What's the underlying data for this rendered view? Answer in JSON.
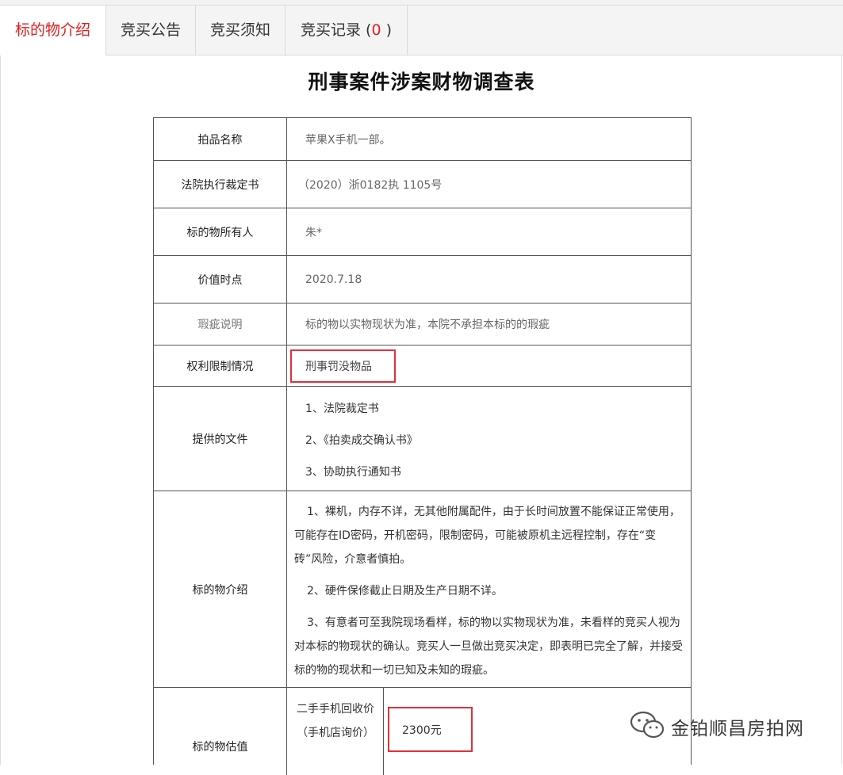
{
  "tabs": [
    {
      "label": "标的物介绍"
    },
    {
      "label": "竞买公告"
    },
    {
      "label": "竞买须知"
    },
    {
      "label": "竞买记录 (",
      "count": "0",
      "suffix": ")"
    }
  ],
  "title": "刑事案件涉案财物调查表",
  "rows": {
    "item_name": {
      "label": "拍品名称",
      "value": "苹果X手机一部。"
    },
    "court_ruling": {
      "label": "法院执行裁定书",
      "value": "（2020）浙0182执 1105号"
    },
    "owner": {
      "label": "标的物所有人",
      "value": "朱*"
    },
    "value_date": {
      "label": "价值时点",
      "value": "2020.7.18"
    },
    "defects": {
      "label": "瑕疵说明",
      "value": "标的物以实物现状为准，本院不承担本标的的瑕疵"
    },
    "rights": {
      "label": "权利限制情况",
      "value": "刑事罚没物品"
    },
    "documents": {
      "label": "提供的文件",
      "items": [
        "1、法院裁定书",
        "2、《拍卖成交确认书》",
        "3、协助执行通知书"
      ]
    },
    "intro": {
      "label": "标的物介绍",
      "paragraphs": [
        "1、裸机，内存不详，无其他附属配件，由于长时间放置不能保证正常使用，可能存在ID密码，开机密码，限制密码，可能被原机主远程控制，存在“变砖”风险，介意者慎拍。",
        "2、硬件保修截止日期及生产日期不详。",
        "3、有意者可至我院现场看样，标的物以实物现状为准，未看样的竞买人视为对本标的物现状的确认。竞买人一旦做出竞买决定，即表明已完全了解，并接受标的物的现状和一切已知及未知的瑕疵。"
      ]
    },
    "valuation": {
      "label": "标的物估值",
      "sub_label": "二手手机回收价（手机店询价）",
      "value": "2300元"
    }
  },
  "watermark": {
    "text": "金铂顺昌房拍网",
    "icon": "wechat-icon"
  },
  "colors": {
    "accent_red": "#e02020",
    "highlight_box": "#e0303a"
  }
}
